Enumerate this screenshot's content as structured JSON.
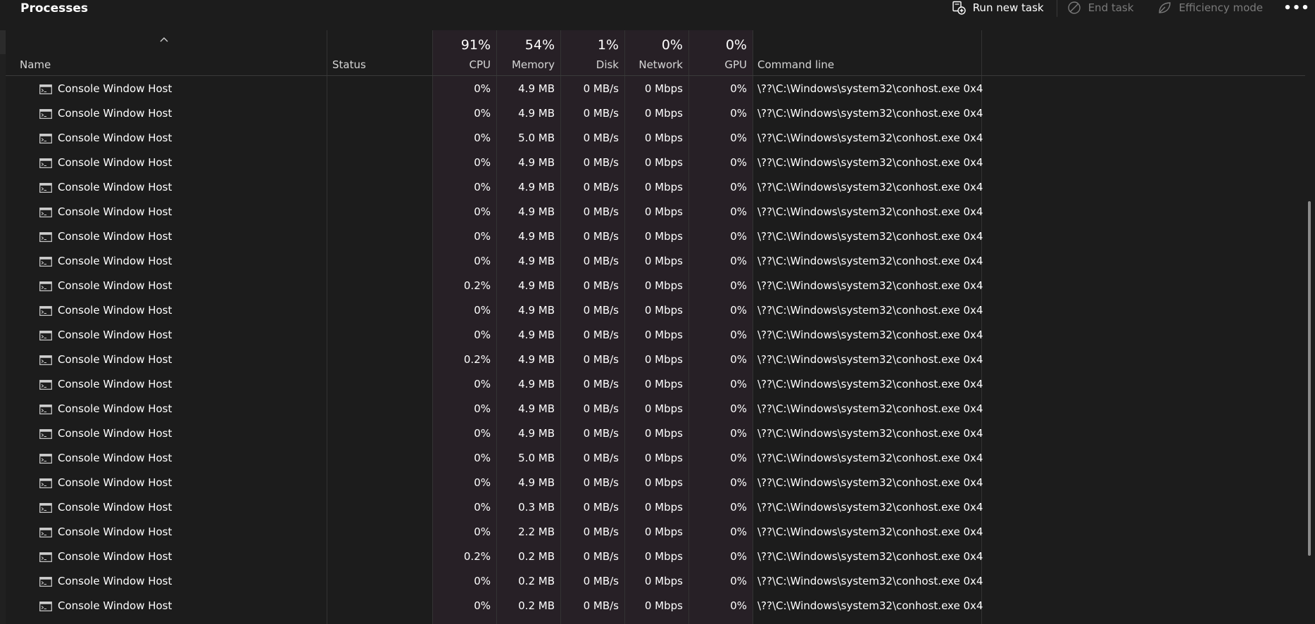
{
  "header": {
    "title": "Processes"
  },
  "toolbar": {
    "run_new_task": "Run new task",
    "end_task": "End task",
    "efficiency_mode": "Efficiency mode",
    "more": "•••"
  },
  "columns": {
    "name": "Name",
    "status": "Status",
    "cpu": {
      "label": "CPU",
      "pct": "91%"
    },
    "memory": {
      "label": "Memory",
      "pct": "54%"
    },
    "disk": {
      "label": "Disk",
      "pct": "1%"
    },
    "network": {
      "label": "Network",
      "pct": "0%"
    },
    "gpu": {
      "label": "GPU",
      "pct": "0%"
    },
    "command_line": "Command line"
  },
  "rows": [
    {
      "name": "Console Window Host",
      "cpu": "0%",
      "memory": "4.9 MB",
      "disk": "0 MB/s",
      "network": "0 Mbps",
      "gpu": "0%",
      "cmd": "\\??\\C:\\Windows\\system32\\conhost.exe 0x4"
    },
    {
      "name": "Console Window Host",
      "cpu": "0%",
      "memory": "4.9 MB",
      "disk": "0 MB/s",
      "network": "0 Mbps",
      "gpu": "0%",
      "cmd": "\\??\\C:\\Windows\\system32\\conhost.exe 0x4"
    },
    {
      "name": "Console Window Host",
      "cpu": "0%",
      "memory": "5.0 MB",
      "disk": "0 MB/s",
      "network": "0 Mbps",
      "gpu": "0%",
      "cmd": "\\??\\C:\\Windows\\system32\\conhost.exe 0x4"
    },
    {
      "name": "Console Window Host",
      "cpu": "0%",
      "memory": "4.9 MB",
      "disk": "0 MB/s",
      "network": "0 Mbps",
      "gpu": "0%",
      "cmd": "\\??\\C:\\Windows\\system32\\conhost.exe 0x4"
    },
    {
      "name": "Console Window Host",
      "cpu": "0%",
      "memory": "4.9 MB",
      "disk": "0 MB/s",
      "network": "0 Mbps",
      "gpu": "0%",
      "cmd": "\\??\\C:\\Windows\\system32\\conhost.exe 0x4"
    },
    {
      "name": "Console Window Host",
      "cpu": "0%",
      "memory": "4.9 MB",
      "disk": "0 MB/s",
      "network": "0 Mbps",
      "gpu": "0%",
      "cmd": "\\??\\C:\\Windows\\system32\\conhost.exe 0x4"
    },
    {
      "name": "Console Window Host",
      "cpu": "0%",
      "memory": "4.9 MB",
      "disk": "0 MB/s",
      "network": "0 Mbps",
      "gpu": "0%",
      "cmd": "\\??\\C:\\Windows\\system32\\conhost.exe 0x4"
    },
    {
      "name": "Console Window Host",
      "cpu": "0%",
      "memory": "4.9 MB",
      "disk": "0 MB/s",
      "network": "0 Mbps",
      "gpu": "0%",
      "cmd": "\\??\\C:\\Windows\\system32\\conhost.exe 0x4"
    },
    {
      "name": "Console Window Host",
      "cpu": "0.2%",
      "memory": "4.9 MB",
      "disk": "0 MB/s",
      "network": "0 Mbps",
      "gpu": "0%",
      "cmd": "\\??\\C:\\Windows\\system32\\conhost.exe 0x4"
    },
    {
      "name": "Console Window Host",
      "cpu": "0%",
      "memory": "4.9 MB",
      "disk": "0 MB/s",
      "network": "0 Mbps",
      "gpu": "0%",
      "cmd": "\\??\\C:\\Windows\\system32\\conhost.exe 0x4"
    },
    {
      "name": "Console Window Host",
      "cpu": "0%",
      "memory": "4.9 MB",
      "disk": "0 MB/s",
      "network": "0 Mbps",
      "gpu": "0%",
      "cmd": "\\??\\C:\\Windows\\system32\\conhost.exe 0x4"
    },
    {
      "name": "Console Window Host",
      "cpu": "0.2%",
      "memory": "4.9 MB",
      "disk": "0 MB/s",
      "network": "0 Mbps",
      "gpu": "0%",
      "cmd": "\\??\\C:\\Windows\\system32\\conhost.exe 0x4"
    },
    {
      "name": "Console Window Host",
      "cpu": "0%",
      "memory": "4.9 MB",
      "disk": "0 MB/s",
      "network": "0 Mbps",
      "gpu": "0%",
      "cmd": "\\??\\C:\\Windows\\system32\\conhost.exe 0x4"
    },
    {
      "name": "Console Window Host",
      "cpu": "0%",
      "memory": "4.9 MB",
      "disk": "0 MB/s",
      "network": "0 Mbps",
      "gpu": "0%",
      "cmd": "\\??\\C:\\Windows\\system32\\conhost.exe 0x4"
    },
    {
      "name": "Console Window Host",
      "cpu": "0%",
      "memory": "4.9 MB",
      "disk": "0 MB/s",
      "network": "0 Mbps",
      "gpu": "0%",
      "cmd": "\\??\\C:\\Windows\\system32\\conhost.exe 0x4"
    },
    {
      "name": "Console Window Host",
      "cpu": "0%",
      "memory": "5.0 MB",
      "disk": "0 MB/s",
      "network": "0 Mbps",
      "gpu": "0%",
      "cmd": "\\??\\C:\\Windows\\system32\\conhost.exe 0x4"
    },
    {
      "name": "Console Window Host",
      "cpu": "0%",
      "memory": "4.9 MB",
      "disk": "0 MB/s",
      "network": "0 Mbps",
      "gpu": "0%",
      "cmd": "\\??\\C:\\Windows\\system32\\conhost.exe 0x4"
    },
    {
      "name": "Console Window Host",
      "cpu": "0%",
      "memory": "0.3 MB",
      "disk": "0 MB/s",
      "network": "0 Mbps",
      "gpu": "0%",
      "cmd": "\\??\\C:\\Windows\\system32\\conhost.exe 0x4"
    },
    {
      "name": "Console Window Host",
      "cpu": "0%",
      "memory": "2.2 MB",
      "disk": "0 MB/s",
      "network": "0 Mbps",
      "gpu": "0%",
      "cmd": "\\??\\C:\\Windows\\system32\\conhost.exe 0x4"
    },
    {
      "name": "Console Window Host",
      "cpu": "0.2%",
      "memory": "0.2 MB",
      "disk": "0 MB/s",
      "network": "0 Mbps",
      "gpu": "0%",
      "cmd": "\\??\\C:\\Windows\\system32\\conhost.exe 0x4"
    },
    {
      "name": "Console Window Host",
      "cpu": "0%",
      "memory": "0.2 MB",
      "disk": "0 MB/s",
      "network": "0 Mbps",
      "gpu": "0%",
      "cmd": "\\??\\C:\\Windows\\system32\\conhost.exe 0x4"
    },
    {
      "name": "Console Window Host",
      "cpu": "0%",
      "memory": "0.2 MB",
      "disk": "0 MB/s",
      "network": "0 Mbps",
      "gpu": "0%",
      "cmd": "\\??\\C:\\Windows\\system32\\conhost.exe 0x4"
    }
  ],
  "icons": {
    "run_new_task": "run-task-icon",
    "end_task": "end-task-icon",
    "efficiency_mode": "leaf-icon",
    "process": "console-window-icon",
    "sort": "sort-ascending-icon"
  },
  "colors": {
    "background": "#1c1c1c",
    "resource_column_tint": "#272026",
    "disabled_text": "#7a7a7a"
  }
}
